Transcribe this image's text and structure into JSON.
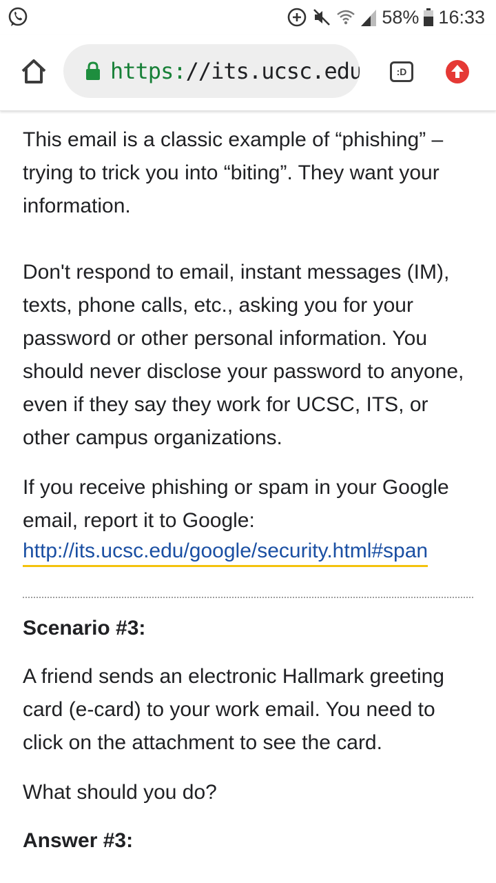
{
  "status_bar": {
    "battery": "58%",
    "time": "16:33",
    "icons": [
      "whatsapp-icon",
      "data-saver-icon",
      "mute-icon",
      "wifi-icon",
      "signal-icon",
      "battery-icon"
    ]
  },
  "toolbar": {
    "url_scheme": "https:",
    "url_rest": "//its.ucsc.edu/s",
    "tabs_label": ":D",
    "icons": [
      "home-icon",
      "lock-icon",
      "update-icon"
    ],
    "colors": {
      "lock": "#1e8e3e",
      "update": "#e53935",
      "scheme": "#188038"
    }
  },
  "content": {
    "para1": "This email is a classic example of “phishing” – trying to trick you into “biting”. They want your information.",
    "para2": "Don't respond to email, instant messages (IM), texts, phone calls, etc., asking you for your password or other personal information. You should never disclose your password to anyone, even if they say they work for UCSC, ITS, or other campus organizations.",
    "para3": "If you receive phishing or spam in your Google email, report it to Google:",
    "link": "http://its.ucsc.edu/google/security.html#span",
    "heading": "Scenario #3:",
    "para4": "A friend sends an electronic Hallmark greeting card (e-card) to your work email. You need to click on the attachment to see the card.",
    "para5": "What should you do?",
    "heading2": "Answer #3:",
    "colors": {
      "link": "#1a4fa3",
      "link_underline": "#f4c20d"
    }
  }
}
